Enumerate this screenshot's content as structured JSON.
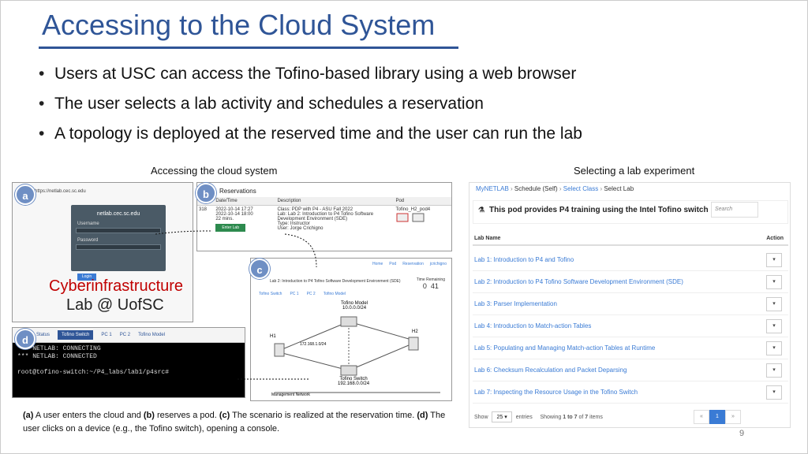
{
  "slide": {
    "title": "Accessing to the Cloud System",
    "bullets": [
      "Users at USC can access the Tofino-based library using a web browser",
      "The user selects a lab activity and schedules a reservation",
      "A topology is deployed at the reserved time and the user can run the lab"
    ],
    "left_caption": "Accessing the cloud system",
    "right_caption": "Selecting a lab experiment",
    "page_number": "9",
    "figure_caption": {
      "a": "(a)",
      "t1": " A user enters the cloud and ",
      "b": "(b)",
      "t2": " reserves a pod. ",
      "c": "(c)",
      "t3": " The scenario is realized at the reservation time. ",
      "d": "(d)",
      "t4": " The user clicks on a device (e.g., the Tofino switch), opening a console."
    }
  },
  "panel_a": {
    "badge": "a",
    "url": "https://netlab.cec.sc.edu",
    "host": "netlab.cec.sc.edu",
    "username_label": "Username",
    "password_label": "Password",
    "login": "Login",
    "brand1": "Cyberinfrastructure",
    "brand2": "Lab @ UofSC"
  },
  "panel_b": {
    "badge": "b",
    "heading": "Reservations",
    "headers": [
      "",
      "Date/Time",
      "Description",
      "Pod"
    ],
    "id": "318",
    "dates": [
      "2022-10-14 17:27",
      "2022-10-14 18:00",
      "22 mins."
    ],
    "desc": [
      "Class: PDP with P4 - ASU Fall 2022",
      "Lab: Lab 2: Introduction to P4 Tofino Software Development Environment (SDE)",
      "Type: Instructor",
      "User: Jorge Crichigno"
    ],
    "pod": "Tofino_H2_pod4",
    "enter_lab": "Enter Lab"
  },
  "panel_c": {
    "badge": "c",
    "nav": [
      "Home",
      "Pod",
      "Reservation",
      "jcrichigno"
    ],
    "lab_title": "Lab 2: Introduction to P4 Tofino Software Development Environment (SDE)",
    "time_label": "Time Remaining",
    "time": [
      "0",
      "41"
    ],
    "tabs": [
      "Tofino Switch",
      "PC 1",
      "PC 2",
      "Tofino Model"
    ],
    "model_label": "Tofino Model",
    "model_net": "10.0.0.0/24",
    "switch_label": "Tofino Switch",
    "switch_net": "192.168.0.0/24",
    "mid_net": "172.168.1.0/24",
    "mgmt": "Management Network",
    "h1": "H1",
    "h2": "H2"
  },
  "panel_d": {
    "badge": "d",
    "tabs": [
      "Status",
      "Tofino Switch",
      "PC 1",
      "PC 2",
      "Tofino Model"
    ],
    "console": "*** NETLAB: CONNECTING\n*** NETLAB: CONNECTED\n\nroot@tofino-switch:~/P4_labs/lab1/p4src# "
  },
  "mynetlab": {
    "breadcrumb": [
      "MyNETLAB",
      "Schedule (Self)",
      "Select Class",
      "Select Lab"
    ],
    "pod_heading": "This pod provides P4 training using the Intel Tofino switch",
    "search_placeholder": "Search",
    "col_lab": "Lab Name",
    "col_action": "Action",
    "labs": [
      "Lab 1: Introduction to P4 and Tofino",
      "Lab 2: Introduction to P4 Tofino Software Development Environment (SDE)",
      "Lab 3: Parser Implementation",
      "Lab 4: Introduction to Match-action Tables",
      "Lab 5: Populating and Managing Match-action Tables at Runtime",
      "Lab 6: Checksum Recalculation and Packet Deparsing",
      "Lab 7: Inspecting the Resource Usage in the Tofino Switch"
    ],
    "show": "Show",
    "page_size": "25",
    "entries": "entries",
    "showing_pre": "Showing",
    "showing_range": "1 to 7",
    "showing_of": "of",
    "showing_total": "7",
    "showing_items": "items",
    "pager": [
      "«",
      "1",
      "»"
    ]
  }
}
